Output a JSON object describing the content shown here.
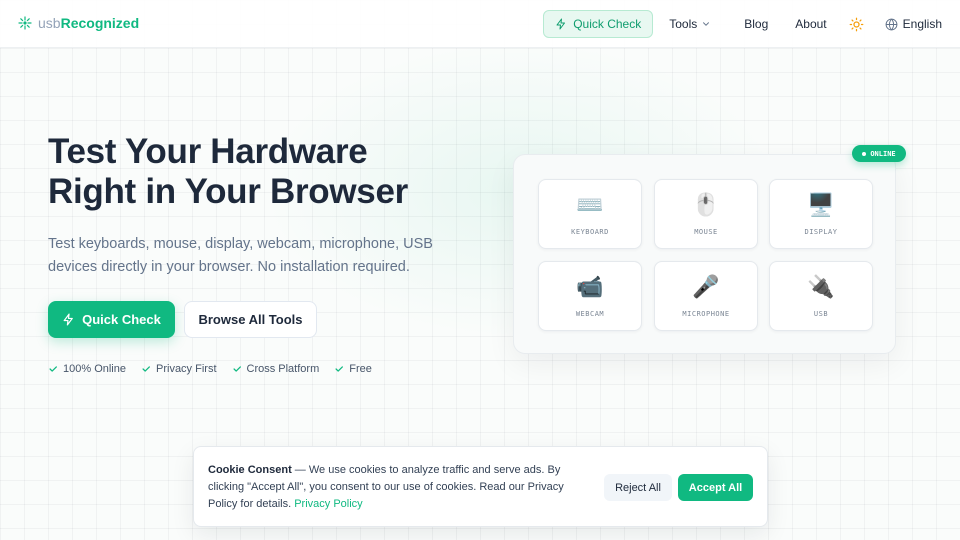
{
  "header": {
    "logo_prefix": "usb",
    "logo_suffix": "Recognized",
    "nav": {
      "quick_check": "Quick Check",
      "tools": "Tools",
      "blog": "Blog",
      "about": "About",
      "language": "English"
    }
  },
  "hero": {
    "title_line1": "Test Your Hardware",
    "title_line2": "Right in Your Browser",
    "subtitle": "Test keyboards, mouse, display, webcam, microphone, USB devices directly in your browser. No installation required.",
    "primary_button": "Quick Check",
    "secondary_button": "Browse All Tools",
    "features": [
      "100% Online",
      "Privacy First",
      "Cross Platform",
      "Free"
    ]
  },
  "devices": {
    "badge": "ONLINE",
    "tiles": [
      {
        "label": "KEYBOARD",
        "icon": "⌨️"
      },
      {
        "label": "MOUSE",
        "icon": "🖱️"
      },
      {
        "label": "DISPLAY",
        "icon": "🖥️"
      },
      {
        "label": "WEBCAM",
        "icon": "📹"
      },
      {
        "label": "MICROPHONE",
        "icon": "🎤"
      },
      {
        "label": "USB",
        "icon": "🔌"
      }
    ]
  },
  "cookie": {
    "title": "Cookie Consent",
    "body": " — We use cookies to analyze traffic and serve ads. By clicking \"Accept All\", you consent to our use of cookies. Read our Privacy Policy for details. ",
    "link": "Privacy Policy",
    "reject": "Reject All",
    "accept": "Accept All"
  },
  "colors": {
    "accent": "#10b981",
    "text": "#1e293b",
    "muted": "#64748b"
  }
}
